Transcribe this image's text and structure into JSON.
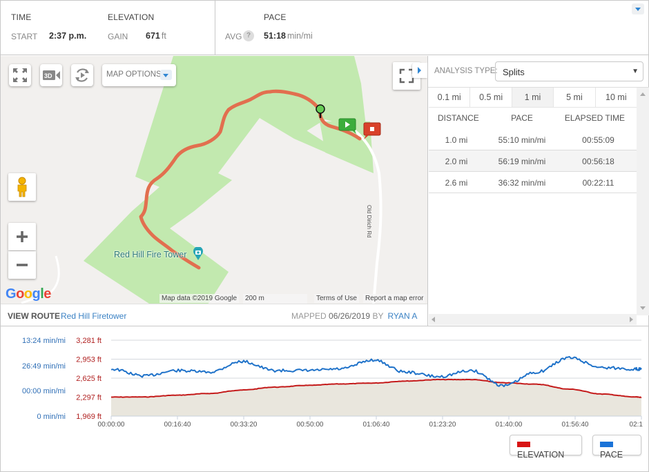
{
  "summary": {
    "time": {
      "heading": "TIME",
      "label": "START",
      "value": "2:37 p.m."
    },
    "elevation": {
      "heading": "ELEVATION",
      "label": "GAIN",
      "value": "671",
      "unit": "ft"
    },
    "pace": {
      "heading": "PACE",
      "label": "AVG",
      "help": "?",
      "value": "51:18",
      "unit": "min/mi"
    }
  },
  "map": {
    "controls": {
      "fullscreen": "expand-icon",
      "three_d": "3D",
      "rotate": "rotate-icon",
      "options_label": "MAP OPTIONS"
    },
    "place_label": "Red Hill Fire Tower",
    "road_label": "Old Dirich Rd",
    "logo": [
      "G",
      "o",
      "o",
      "g",
      "l",
      "e"
    ],
    "attribution": {
      "data": "Map data ©2019 Google",
      "scale": "200 m",
      "terms": "Terms of Use",
      "report": "Report a map error"
    },
    "zoom_in": "+",
    "zoom_out": "−"
  },
  "route": {
    "view_label": "VIEW ROUTE",
    "route_name": "Red Hill Firetower",
    "mapped_label": "MAPPED",
    "mapped_date": "06/26/2019",
    "by_label": "BY",
    "author": "RYAN A"
  },
  "analysis": {
    "type_label": "ANALYSIS TYPE:",
    "type_value": "Splits",
    "segments": [
      "0.1 mi",
      "0.5 mi",
      "1 mi",
      "5 mi",
      "10 mi"
    ],
    "active_segment": "1 mi",
    "columns": [
      "DISTANCE",
      "PACE",
      "ELAPSED TIME"
    ],
    "rows": [
      {
        "distance": "1.0 mi",
        "pace": "55:10 min/mi",
        "elapsed": "00:55:09"
      },
      {
        "distance": "2.0 mi",
        "pace": "56:19 min/mi",
        "elapsed": "00:56:18"
      },
      {
        "distance": "2.6 mi",
        "pace": "36:32 min/mi",
        "elapsed": "00:22:11"
      }
    ]
  },
  "chart_data": {
    "type": "line",
    "title": "",
    "x_tick_labels": [
      "00:00:00",
      "00:16:40",
      "00:33:20",
      "00:50:00",
      "01:06:40",
      "01:23:20",
      "01:40:00",
      "01:56:40",
      "02:1"
    ],
    "x_range_seconds": [
      0,
      8100
    ],
    "y_left_pace_ticks": [
      "13:24 min/mi",
      "26:49 min/mi",
      "00:00 min/mi",
      "0 min/mi"
    ],
    "y_right_elevation_ticks": [
      "3,281 ft",
      "2,953 ft",
      "2,625 ft",
      "2,297 ft",
      "1,969 ft"
    ],
    "elevation_range_ft": [
      1969,
      3281
    ],
    "grid": true,
    "legend": {
      "position": "bottom-right",
      "entries": [
        "ELEVATION",
        "PACE"
      ]
    },
    "colors": {
      "elevation": "#c41a1a",
      "pace": "#1f72c9",
      "area": "#e9e6dd"
    },
    "x_seconds": [
      0,
      500,
      1000,
      1500,
      2000,
      2500,
      3000,
      3500,
      4000,
      4500,
      5000,
      5500,
      6000,
      6500,
      7000,
      7500,
      8000,
      8100
    ],
    "series": [
      {
        "name": "ELEVATION",
        "unit": "ft",
        "values": [
          2297,
          2300,
          2330,
          2360,
          2420,
          2470,
          2500,
          2525,
          2540,
          2575,
          2600,
          2600,
          2545,
          2520,
          2435,
          2350,
          2300,
          2294
        ]
      },
      {
        "name": "PACE",
        "unit": "index 0-1 of plot height",
        "values": [
          0.62,
          0.53,
          0.6,
          0.58,
          0.72,
          0.6,
          0.6,
          0.62,
          0.74,
          0.58,
          0.52,
          0.6,
          0.4,
          0.58,
          0.77,
          0.64,
          0.62,
          0.62
        ]
      }
    ]
  },
  "legend": {
    "elevation_label": "ELEVATION",
    "pace_label": "PACE"
  }
}
